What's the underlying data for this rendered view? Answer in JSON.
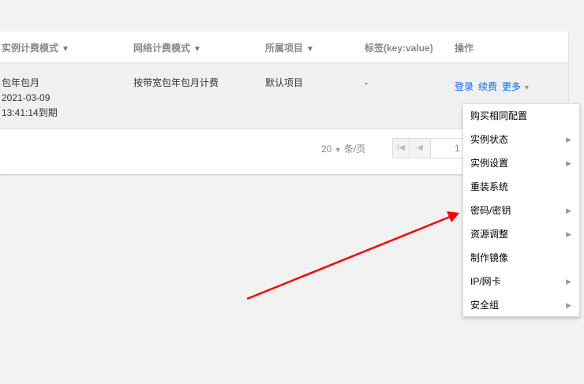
{
  "table": {
    "headers": [
      "实例计费模式",
      "网络计费模式",
      "所属项目",
      "标签(key:value)",
      "操作"
    ],
    "row": {
      "billing": [
        "包年包月",
        "2021-03-09",
        "13:41:14到期"
      ],
      "network": "按带宽包年包月计费",
      "project": "默认项目",
      "tags": "-",
      "actions": {
        "login": "登录",
        "renew": "续费",
        "more": "更多"
      }
    }
  },
  "pagination": {
    "page_size": "20",
    "per_page_label": "条/页",
    "current_page": "1"
  },
  "menu": {
    "items": [
      {
        "label": "购买相同配置",
        "submenu": false
      },
      {
        "label": "实例状态",
        "submenu": true
      },
      {
        "label": "实例设置",
        "submenu": true
      },
      {
        "label": "重装系统",
        "submenu": false
      },
      {
        "label": "密码/密钥",
        "submenu": true
      },
      {
        "label": "资源调整",
        "submenu": true
      },
      {
        "label": "制作镜像",
        "submenu": false
      },
      {
        "label": "IP/网卡",
        "submenu": true
      },
      {
        "label": "安全组",
        "submenu": true
      }
    ]
  },
  "colors": {
    "link": "#006eff",
    "annotation_arrow": "#ff0000"
  }
}
